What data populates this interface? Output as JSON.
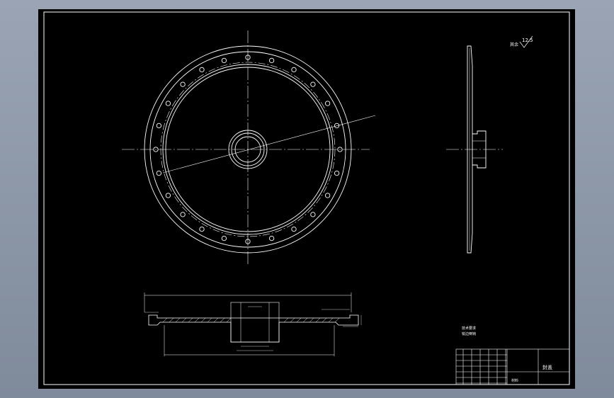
{
  "roughness_note": {
    "prefix": "其余",
    "value": "12.5"
  },
  "labels": {
    "tech_req_title": "技术要求",
    "tech_req_line1": "锐边倒钝",
    "title_block_name": "封盖",
    "title_block_material": "材料"
  },
  "colors": {
    "line": "#ffffff",
    "background": "#000000",
    "frame": "#ffffff"
  }
}
